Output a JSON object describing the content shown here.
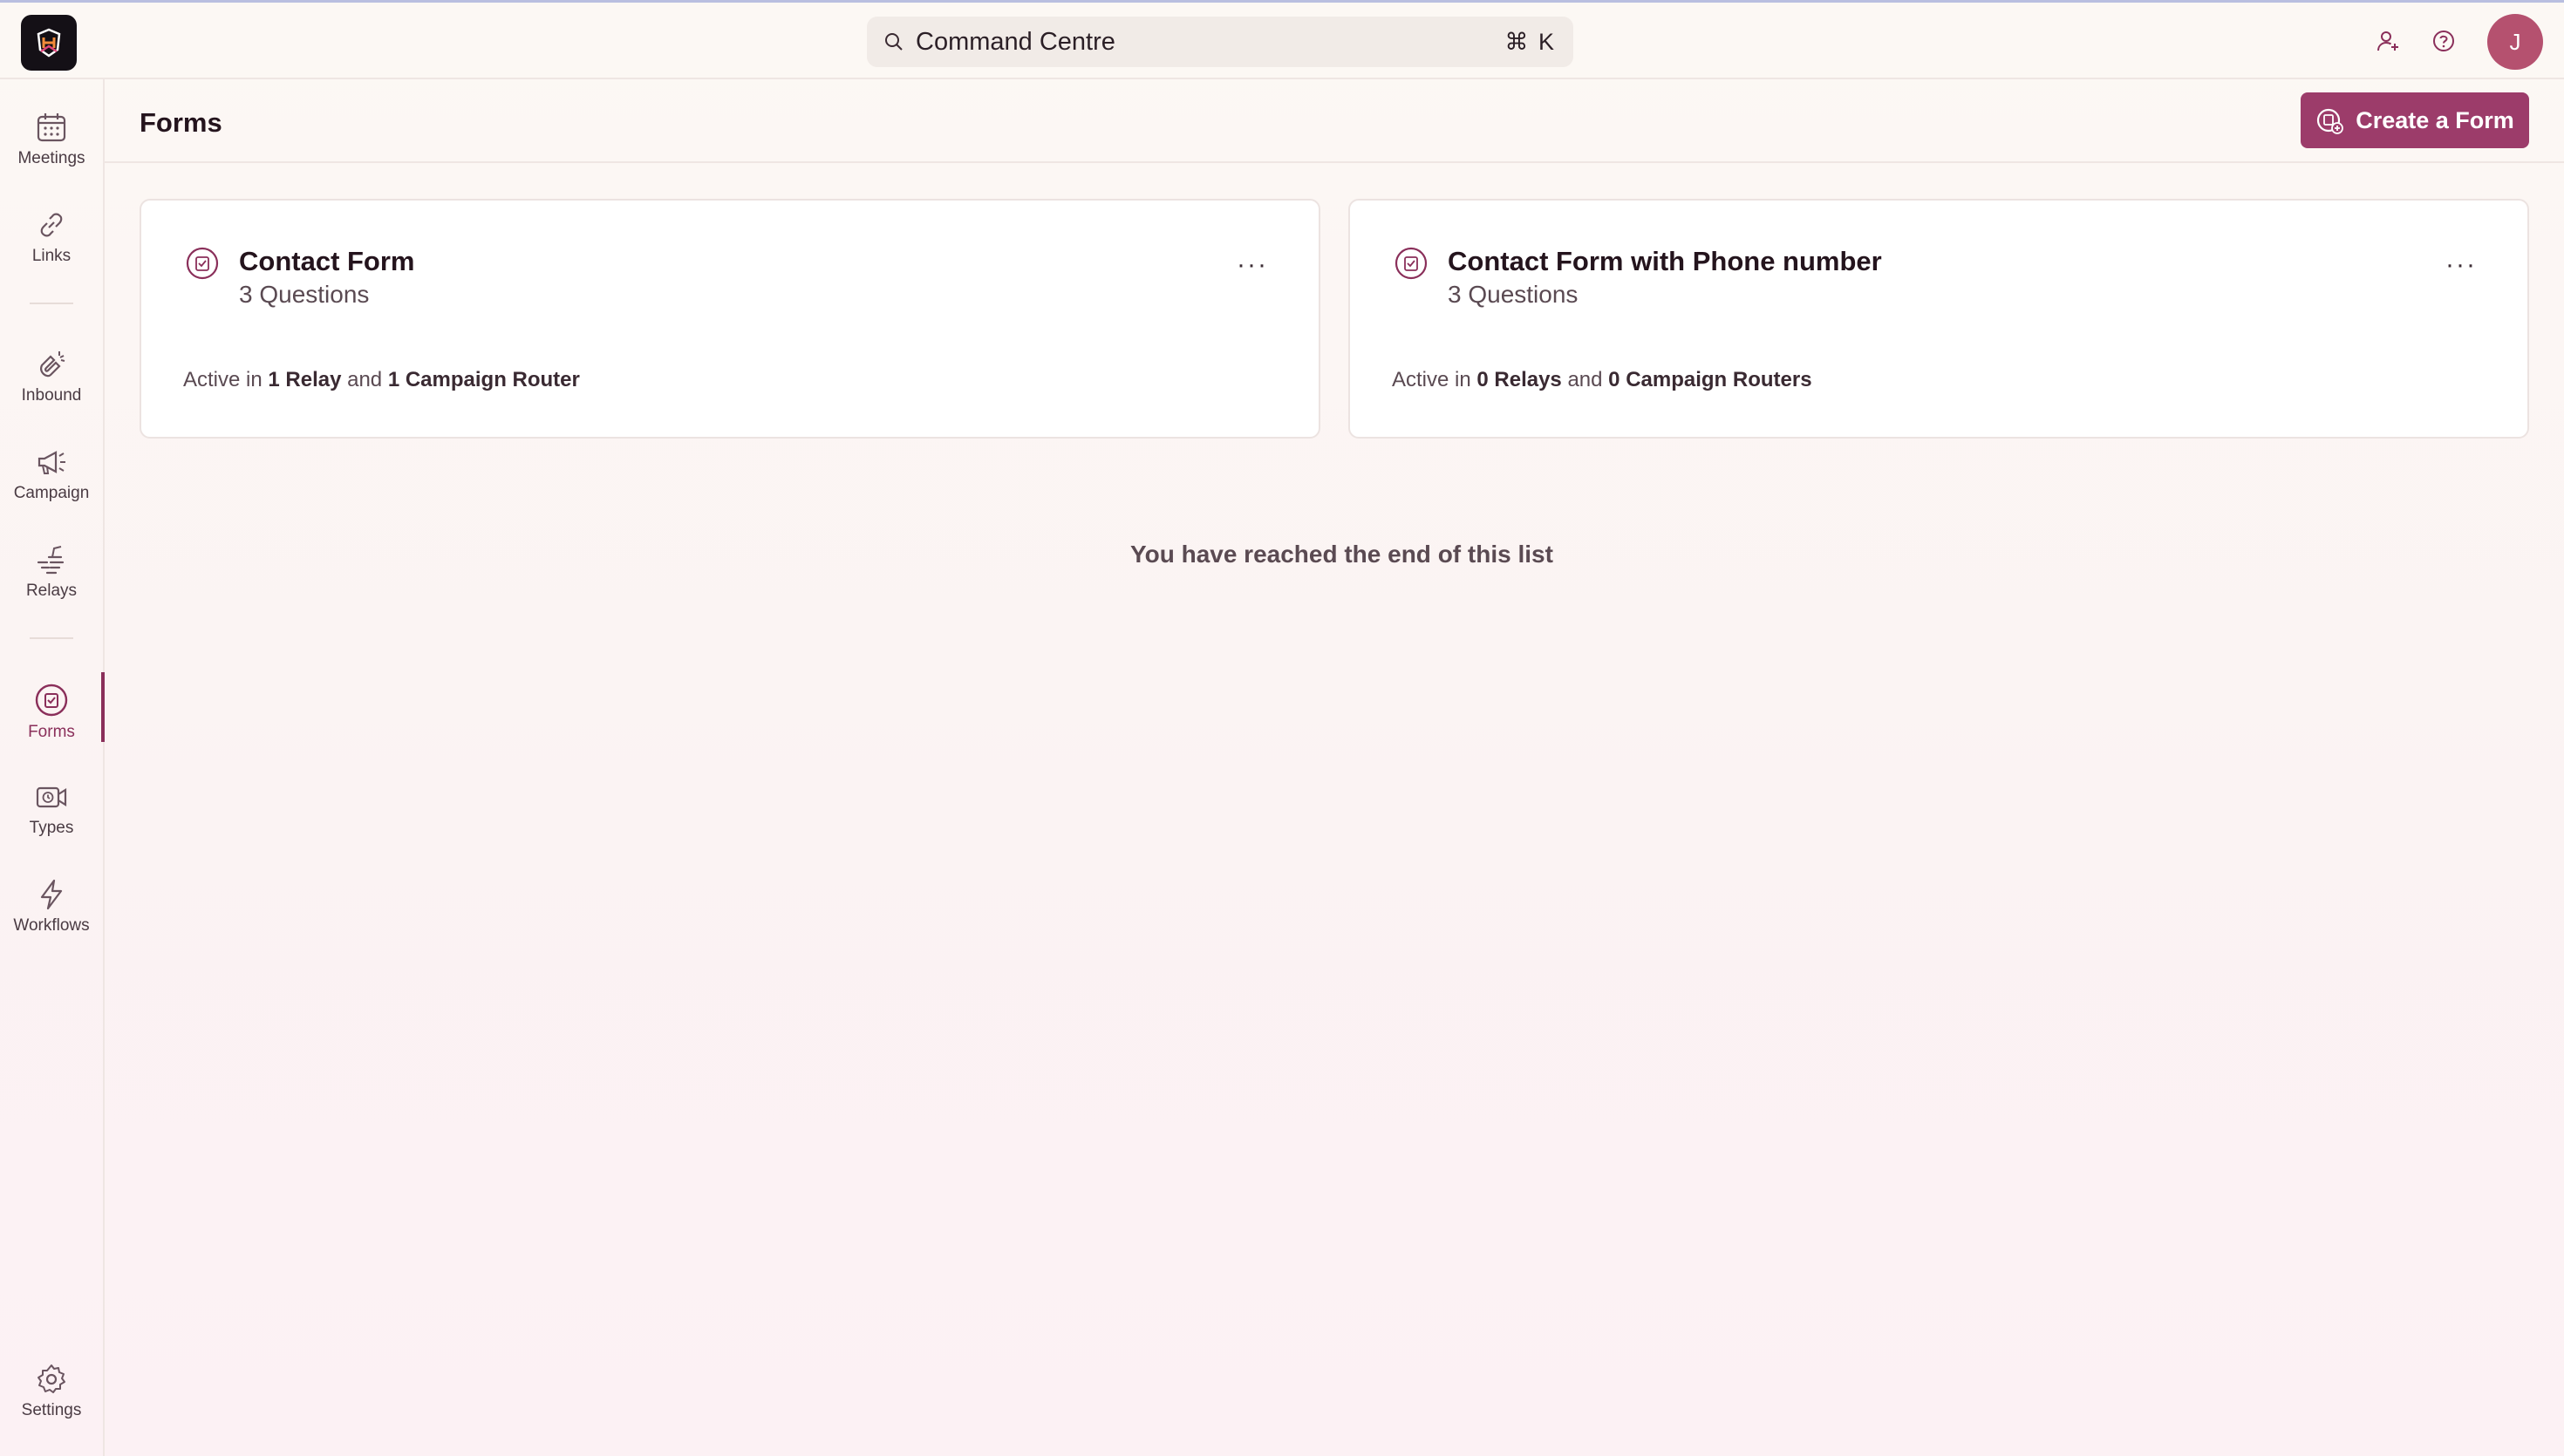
{
  "app": {
    "avatar_initial": "J",
    "accent": "#9c3c6a"
  },
  "search": {
    "label": "Command Centre",
    "shortcut": "⌘ K"
  },
  "sidebar": {
    "items": [
      {
        "label": "Meetings",
        "icon": "calendar-icon"
      },
      {
        "label": "Links",
        "icon": "link-icon"
      },
      {
        "label": "Inbound",
        "icon": "magnet-icon"
      },
      {
        "label": "Campaign",
        "icon": "megaphone-icon"
      },
      {
        "label": "Relays",
        "icon": "relay-hand-icon"
      },
      {
        "label": "Forms",
        "icon": "form-icon",
        "active": true
      },
      {
        "label": "Types",
        "icon": "video-clock-icon"
      },
      {
        "label": "Workflows",
        "icon": "lightning-icon"
      },
      {
        "label": "Settings",
        "icon": "gear-icon"
      }
    ]
  },
  "header": {
    "title": "Forms",
    "create_button": "Create a Form"
  },
  "forms": [
    {
      "title": "Contact Form",
      "questions": "3 Questions",
      "status_prefix": "Active in",
      "relays": "1 Relay",
      "joiner": "and",
      "routers": "1 Campaign Router"
    },
    {
      "title": "Contact Form with Phone number",
      "questions": "3 Questions",
      "status_prefix": "Active in",
      "relays": "0 Relays",
      "joiner": "and",
      "routers": "0 Campaign Routers"
    }
  ],
  "list_end": "You have reached the end of this list",
  "more_glyph": "···"
}
